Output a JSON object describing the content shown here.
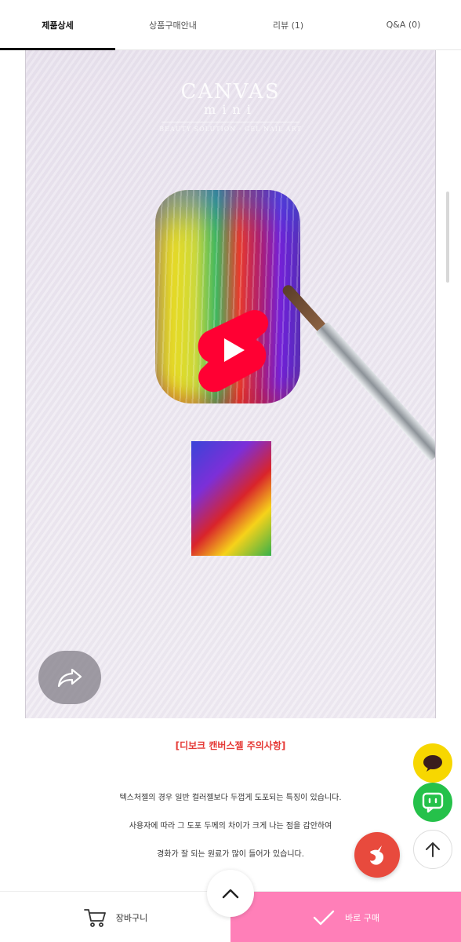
{
  "tabs": [
    {
      "label": "제품상세"
    },
    {
      "label": "상품구매안내"
    },
    {
      "label": "리뷰 (1)"
    },
    {
      "label": "Q&A (0)"
    }
  ],
  "video": {
    "brand_title": "CANVAS",
    "brand_sub": "mini",
    "brand_tag": "BEAUTY SOLUTION · GEL NAIL ART"
  },
  "notice": {
    "title": "[디보크 캔버스젤 주의사항]",
    "lines": [
      "텍스처젤의 경우 일반 컬러젤보다 두껍게 도포되는 특징이 있습니다.",
      "사용자에 따라 그 도포 두께의 차이가 크게 나는 점을 감안하여",
      "경화가 잘 되는 원료가 많이 들어가 있습니다."
    ]
  },
  "bottom_bar": {
    "cart_label": "장바구니",
    "buy_label": "바로 구매"
  },
  "colors": {
    "accent_pink": "#ff7fb8",
    "notice_red": "#e53935",
    "kakao_yellow": "#f7d700",
    "talk_green": "#25c14a",
    "brand_red": "#e84a3d",
    "youtube_red": "#ff0033"
  },
  "icons": {
    "share": "share-arrow-icon",
    "kakao": "kakao-chat-icon",
    "talk": "talk-chat-icon",
    "scroll_top": "arrow-up-icon",
    "brand": "unicorn-logo-icon",
    "collapse": "chevron-up-icon",
    "cart": "cart-icon",
    "check": "check-icon",
    "play": "youtube-shorts-play-icon"
  }
}
